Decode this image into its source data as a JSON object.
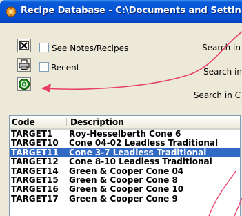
{
  "window": {
    "title": "Recipe Database - C:\\Documents and Settin"
  },
  "toolbar": {
    "close_icon": "close-x-icon",
    "print_icon": "printer-icon",
    "target_icon": "target-icon"
  },
  "options": {
    "see_notes_label": "See Notes/Recipes",
    "recent_label": "Recent"
  },
  "search": {
    "labels": [
      "Search in",
      "Search in",
      "Search in C"
    ]
  },
  "table": {
    "columns": [
      "Code",
      "Description"
    ],
    "rows": [
      {
        "code": "TARGET1",
        "description": "Roy-Hesselberth Cone 6"
      },
      {
        "code": "TARGET10",
        "description": "Cone 04-02 Leadless Traditional"
      },
      {
        "code": "TARGET11",
        "description": "Cone 3-7 Leadless Traditional",
        "selected": true
      },
      {
        "code": "TARGET12",
        "description": "Cone 8-10 Leadless Traditional"
      },
      {
        "code": "TARGET14",
        "description": "Green & Cooper Cone 04"
      },
      {
        "code": "TARGET15",
        "description": "Green & Cooper Cone 8"
      },
      {
        "code": "TARGET16",
        "description": "Green & Cooper Cone 10"
      },
      {
        "code": "TARGET17",
        "description": "Green & Cooper Cone 9"
      }
    ]
  },
  "colors": {
    "titlebar": "#0453d6",
    "selection": "#316ac5",
    "annotation_arrow": "#e8406a"
  }
}
